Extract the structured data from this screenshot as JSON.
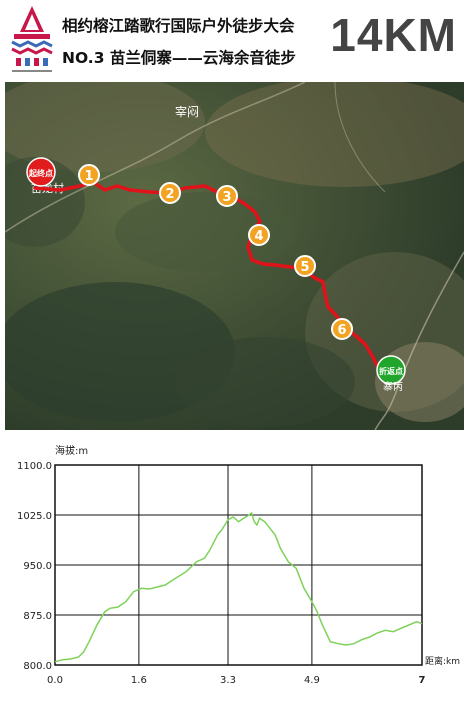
{
  "header": {
    "title_line1": "相约榕江踏歌行国际户外徒步大会",
    "title_line2": "NO.3 苗兰侗寨——云海余音徒步",
    "distance": "14KM"
  },
  "map": {
    "start_label": "起终点",
    "turnaround_label": "折返点",
    "village_label": "寨丙",
    "village2_label": "宰闷",
    "checkpoints": [
      "1",
      "2",
      "3",
      "4",
      "5",
      "6"
    ],
    "colors": {
      "route": "#e0121a",
      "checkpoint": "#f2a321",
      "start": "#e01c1c",
      "turnaround": "#22a52d"
    }
  },
  "chart_data": {
    "type": "line",
    "title": "",
    "ylabel": "海拔:m",
    "xlabel": "距离:km",
    "xlim": [
      0,
      7
    ],
    "ylim": [
      800,
      1100
    ],
    "xticks": [
      "0.0",
      "1.6",
      "3.3",
      "4.9",
      "7"
    ],
    "yticks": [
      "1100.0",
      "1025.0",
      "950.0",
      "875.0",
      "800.0"
    ],
    "series": [
      {
        "x": [
          0,
          0.15,
          0.3,
          0.45,
          0.55,
          0.65,
          0.8,
          0.95,
          1.05,
          1.2,
          1.35,
          1.5,
          1.65,
          1.8,
          1.95,
          2.1,
          2.3,
          2.5,
          2.7,
          2.85,
          2.95,
          3.1,
          3.2,
          3.3,
          3.4,
          3.5,
          3.6,
          3.7,
          3.75,
          3.8,
          3.85,
          3.9,
          4.0,
          4.1,
          4.2,
          4.3,
          4.45,
          4.6,
          4.75,
          4.9,
          5.0,
          5.1,
          5.25,
          5.4,
          5.55,
          5.7,
          5.85,
          6.0,
          6.15,
          6.3,
          6.45,
          6.6,
          6.75,
          6.9,
          7.0
        ],
        "y": [
          805,
          808,
          809,
          812,
          820,
          835,
          860,
          880,
          885,
          887,
          895,
          910,
          915,
          914,
          917,
          920,
          930,
          940,
          955,
          960,
          972,
          995,
          1005,
          1018,
          1022,
          1015,
          1020,
          1025,
          1028,
          1015,
          1010,
          1020,
          1015,
          1005,
          995,
          975,
          955,
          945,
          915,
          895,
          880,
          860,
          835,
          832,
          830,
          832,
          838,
          842,
          848,
          852,
          850,
          855,
          860,
          865,
          862
        ]
      }
    ]
  }
}
